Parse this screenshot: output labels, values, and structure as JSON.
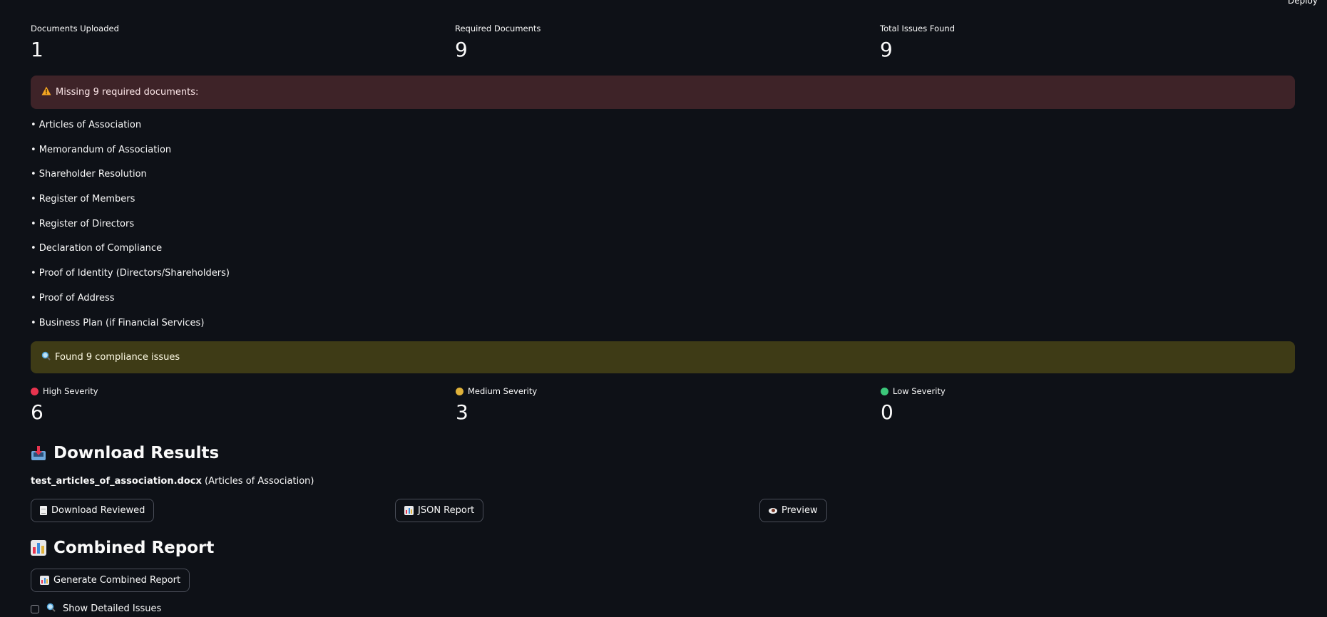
{
  "topbar": {
    "deploy_label": "Deploy"
  },
  "metrics_top": [
    {
      "label": "Documents Uploaded",
      "value": "1"
    },
    {
      "label": "Required Documents",
      "value": "9"
    },
    {
      "label": "Total Issues Found",
      "value": "9"
    }
  ],
  "missing_alert": {
    "icon": "warning-icon",
    "text": "Missing 9 required documents:"
  },
  "missing_items": [
    "• Articles of Association",
    "• Memorandum of Association",
    "• Shareholder Resolution",
    "• Register of Members",
    "• Register of Directors",
    "• Declaration of Compliance",
    "• Proof of Identity (Directors/Shareholders)",
    "• Proof of Address",
    "• Business Plan (if Financial Services)"
  ],
  "issues_alert": {
    "icon": "magnifier-icon",
    "text": "Found 9 compliance issues"
  },
  "severity_metrics": [
    {
      "label": "High Severity",
      "value": "6",
      "color": "#e8344f"
    },
    {
      "label": "Medium Severity",
      "value": "3",
      "color": "#e0b23a"
    },
    {
      "label": "Low Severity",
      "value": "0",
      "color": "#3cc77a"
    }
  ],
  "download_section": {
    "icon": "inbox-tray-icon",
    "heading": "Download Results",
    "file_name": "test_articles_of_association.docx",
    "file_type": " (Articles of Association)",
    "buttons": [
      {
        "label": "Download Reviewed",
        "icon": "document-icon"
      },
      {
        "label": "JSON Report",
        "icon": "bar-chart-icon"
      },
      {
        "label": "Preview",
        "icon": "eye-icon"
      }
    ]
  },
  "combined_section": {
    "icon": "bar-chart-icon",
    "heading": "Combined Report",
    "button_label": "Generate Combined Report",
    "checkbox_label": "Show Detailed Issues",
    "checkbox_checked": false
  },
  "colors": {
    "background": "#0e1117",
    "error_bg": "#3e2328",
    "warning_bg": "#3e3b16",
    "text": "#fafafa"
  }
}
